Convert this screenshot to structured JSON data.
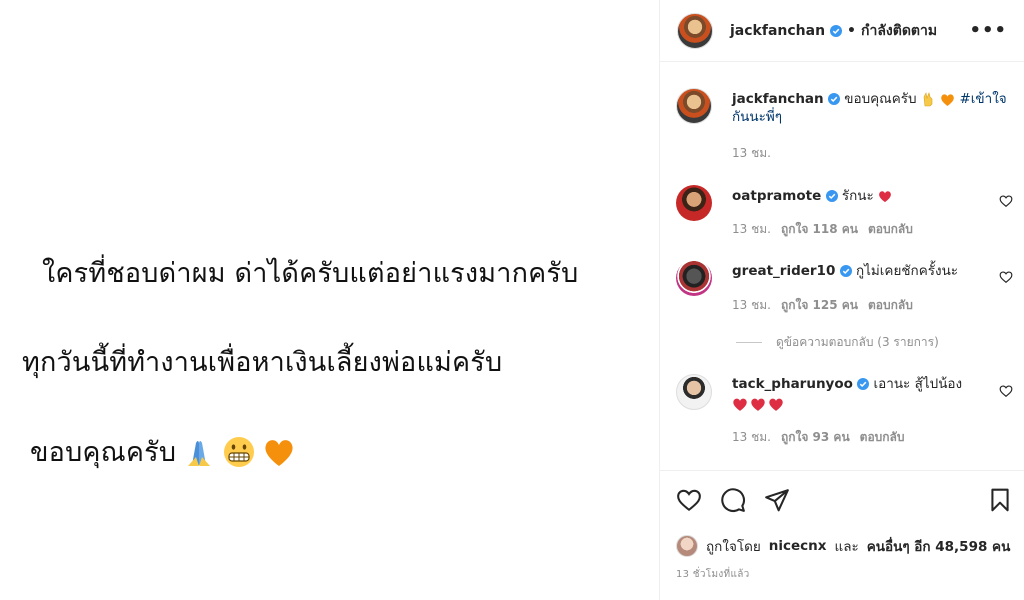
{
  "post": {
    "line1": "ใครที่ชอบด่าผม ด่าได้ครับแต่อย่าแรงมากครับ",
    "line2": "ทุกวันนี้ที่ทำงานเพื่อหาเงินเลี้ยงพ่อแม่ครับ",
    "line3": "ขอบคุณครับ",
    "emoji_icons": [
      "folded-hands-icon",
      "grimacing-face-icon",
      "orange-heart-icon"
    ]
  },
  "header": {
    "username": "jackfanchan",
    "separator": "•",
    "follow_status": "กำลังติดตาม",
    "more": "•••"
  },
  "caption": {
    "username": "jackfanchan",
    "text": "ขอบคุณครับ",
    "hashtag": "#เข้าใจกันนะพี่ๆ",
    "time": "13 ชม."
  },
  "comments": [
    {
      "username": "oatpramote",
      "text": "รักนะ",
      "time": "13 ชม.",
      "likes": "ถูกใจ 118 คน",
      "reply": "ตอบกลับ"
    },
    {
      "username": "great_rider10",
      "text": "กูไม่เคยชักครั้งนะ",
      "time": "13 ชม.",
      "likes": "ถูกใจ 125 คน",
      "reply": "ตอบกลับ"
    },
    {
      "username": "tack_pharunyoo",
      "text": "เอานะ สู้ไปน้อง",
      "time": "13 ชม.",
      "likes": "ถูกใจ 93 คน",
      "reply": "ตอบกลับ"
    }
  ],
  "view_replies": "ดูข้อความตอบกลับ (3 รายการ)",
  "likes_line": {
    "prefix": "ถูกใจโดย",
    "user": "nicecnx",
    "and": "และ",
    "others": "คนอื่นๆ อีก 48,598 คน"
  },
  "time_ago": "13 ชั่วโมงที่แล้ว",
  "colors": {
    "verified": "#3897f0",
    "heart": "#ed4956",
    "orange_heart": "#f4900c"
  }
}
